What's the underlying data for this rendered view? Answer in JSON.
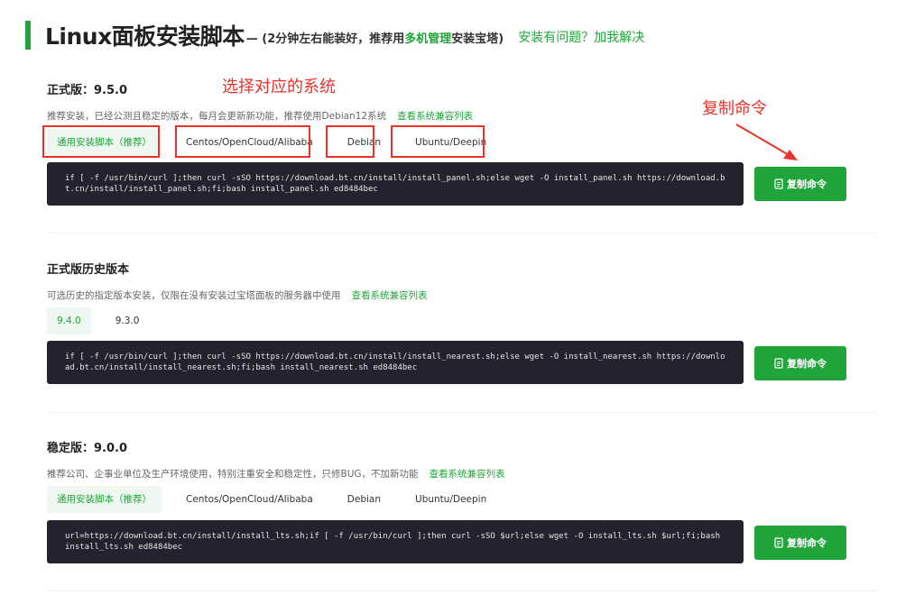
{
  "header": {
    "title": "Linux面板安装脚本",
    "sub_prefix": "— (2分钟左右能装好，推荐用",
    "sub_highlight": "多机管理",
    "sub_suffix": "安装宝塔)",
    "help_link": "安装有问题？加我解决"
  },
  "sections": [
    {
      "title": "正式版：9.5.0",
      "desc": "推荐安装，已经公测且稳定的版本，每月会更新新功能，推荐使用Debian12系统",
      "compat_link": "查看系统兼容列表",
      "tabs": [
        "通用安装脚本（推荐）",
        "Centos/OpenCloud/Alibaba",
        "Debian",
        "Ubuntu/Deepin"
      ],
      "command": "if [ -f /usr/bin/curl ];then curl -sSO https://download.bt.cn/install/install_panel.sh;else wget -O install_panel.sh https://download.bt.cn/install/install_panel.sh;fi;bash install_panel.sh ed8484bec",
      "copy_label": "复制命令"
    },
    {
      "title": "正式版历史版本",
      "desc": "可选历史的指定版本安装，仅限在没有安装过宝塔面板的服务器中使用",
      "compat_link": "查看系统兼容列表",
      "tabs": [
        "9.4.0",
        "9.3.0"
      ],
      "command": "if [ -f /usr/bin/curl ];then curl -sSO https://download.bt.cn/install/install_nearest.sh;else wget -O install_nearest.sh https://download.bt.cn/install/install_nearest.sh;fi;bash install_nearest.sh ed8484bec",
      "copy_label": "复制命令"
    },
    {
      "title": "稳定版：9.0.0",
      "desc": "推荐公司、企事业单位及生产环境使用，特别注重安全和稳定性，只修BUG，不加新功能",
      "compat_link": "查看系统兼容列表",
      "tabs": [
        "通用安装脚本（推荐）",
        "Centos/OpenCloud/Alibaba",
        "Debian",
        "Ubuntu/Deepin"
      ],
      "command": "url=https://download.bt.cn/install/install_lts.sh;if [ -f /usr/bin/curl ];then curl -sSO $url;else wget -O install_lts.sh $url;fi;bash install_lts.sh ed8484bec",
      "copy_label": "复制命令"
    }
  ],
  "annotations": {
    "select_system": "选择对应的系统",
    "copy_command": "复制命令",
    "color": "#e8332b"
  },
  "colors": {
    "accent": "#20a53a",
    "code_bg": "#22232f",
    "tab_active_bg": "#eef8f0"
  }
}
